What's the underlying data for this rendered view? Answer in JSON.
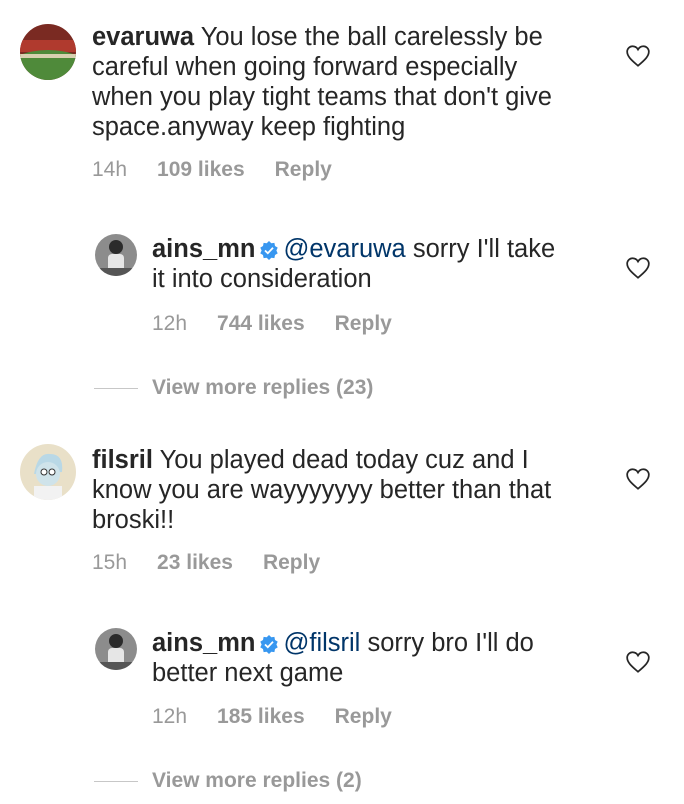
{
  "colors": {
    "text": "#262626",
    "meta": "#999999",
    "mention": "#003569",
    "verified": "#3897f0"
  },
  "comments": [
    {
      "username": "evaruwa",
      "line1": "You lose the ball carelessly be",
      "line2": "careful when going forward especially",
      "line3": "when you play tight teams that don't give",
      "line4": "space.anyway keep fighting",
      "time": "14h",
      "likes": "109 likes",
      "reply": "Reply",
      "reply_comment": {
        "username": "ains_mn",
        "mention": "@evaruwa",
        "line1": "sorry I'll take",
        "line2": "it into consideration",
        "time": "12h",
        "likes": "744 likes",
        "reply": "Reply"
      },
      "view_more": "View more replies (23)"
    },
    {
      "username": "filsril",
      "line1": "You played dead today cuz and I",
      "line2": "know you are wayyyyyyy better than that",
      "line3": "broski!!",
      "time": "15h",
      "likes": "23 likes",
      "reply": "Reply",
      "reply_comment": {
        "username": "ains_mn",
        "mention": "@filsril",
        "line1": "sorry bro I'll do",
        "line2": "better next game",
        "time": "12h",
        "likes": "185 likes",
        "reply": "Reply"
      },
      "view_more": "View more replies (2)"
    }
  ]
}
